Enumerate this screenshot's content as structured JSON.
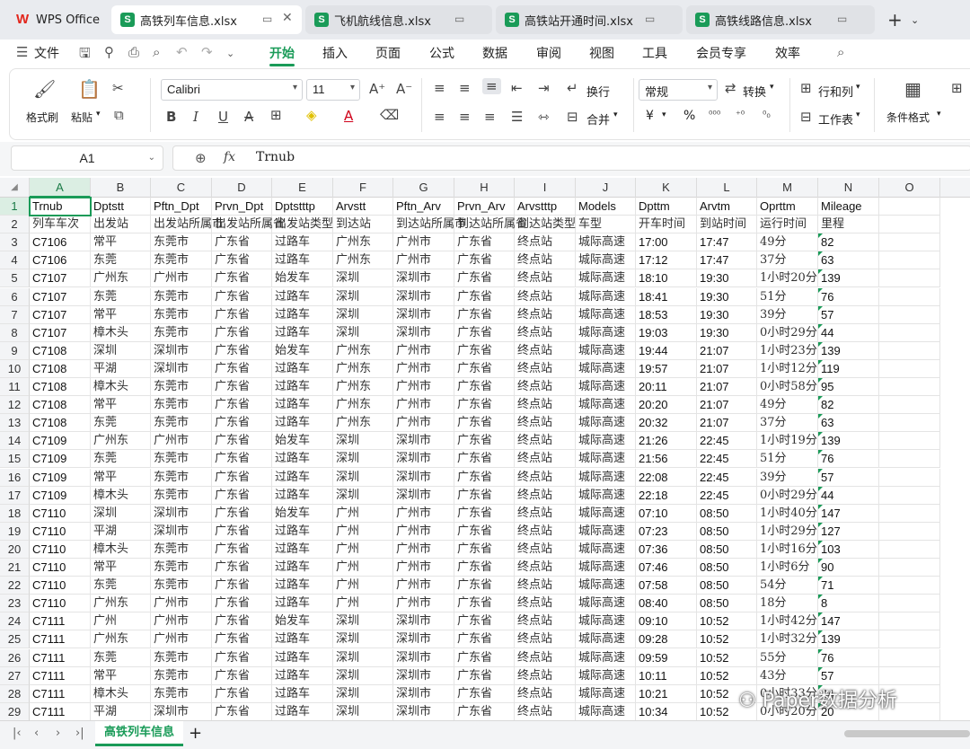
{
  "tabs": [
    {
      "label": "WPS Office",
      "type": "home"
    },
    {
      "label": "高铁列车信息.xlsx",
      "type": "active"
    },
    {
      "label": "飞机航线信息.xlsx",
      "type": "inactive"
    },
    {
      "label": "高铁站开通时间.xlsx",
      "type": "inactive"
    },
    {
      "label": "高铁线路信息.xlsx",
      "type": "inactive"
    }
  ],
  "menu": {
    "file": "文件",
    "items": [
      "开始",
      "插入",
      "页面",
      "公式",
      "数据",
      "审阅",
      "视图",
      "工具",
      "会员专享",
      "效率"
    ],
    "active": "开始"
  },
  "ribbon": {
    "format_painter": "格式刷",
    "paste": "粘贴",
    "font_name": "Calibri",
    "font_size": "11",
    "wrap": "换行",
    "number_format": "常规",
    "convert": "转换",
    "row_col": "行和列",
    "worksheet": "工作表",
    "cond_format": "条件格式",
    "merge": "合并",
    "currency": "¥",
    "percent": "%"
  },
  "formula": {
    "name_box": "A1",
    "fx": "fx",
    "value": "Trnub"
  },
  "columns": [
    "A",
    "B",
    "C",
    "D",
    "E",
    "F",
    "G",
    "H",
    "I",
    "J",
    "K",
    "L",
    "M",
    "N",
    "O"
  ],
  "selected_cell": "A1",
  "rows": [
    [
      "Trnub",
      "Dptstt",
      "Pftn_Dpt",
      "Prvn_Dpt",
      "Dptstttp",
      "Arvstt",
      "Pftn_Arv",
      "Prvn_Arv",
      "Arvstttp",
      "Models",
      "Dpttm",
      "Arvtm",
      "Oprttm",
      "Mileage"
    ],
    [
      "列车车次",
      "出发站",
      "出发站所属市",
      "出发站所属省",
      "出发站类型",
      "到达站",
      "到达站所属市",
      "到达站所属省",
      "到达站类型",
      "车型",
      "开车时间",
      "到站时间",
      "运行时间",
      "里程"
    ],
    [
      "C7106",
      "常平",
      "东莞市",
      "广东省",
      "过路车",
      "广州东",
      "广州市",
      "广东省",
      "终点站",
      "城际高速",
      "17:00",
      "17:47",
      "49分",
      "82"
    ],
    [
      "C7106",
      "东莞",
      "东莞市",
      "广东省",
      "过路车",
      "广州东",
      "广州市",
      "广东省",
      "终点站",
      "城际高速",
      "17:12",
      "17:47",
      "37分",
      "63"
    ],
    [
      "C7107",
      "广州东",
      "广州市",
      "广东省",
      "始发车",
      "深圳",
      "深圳市",
      "广东省",
      "终点站",
      "城际高速",
      "18:10",
      "19:30",
      "1小时20分",
      "139"
    ],
    [
      "C7107",
      "东莞",
      "东莞市",
      "广东省",
      "过路车",
      "深圳",
      "深圳市",
      "广东省",
      "终点站",
      "城际高速",
      "18:41",
      "19:30",
      "51分",
      "76"
    ],
    [
      "C7107",
      "常平",
      "东莞市",
      "广东省",
      "过路车",
      "深圳",
      "深圳市",
      "广东省",
      "终点站",
      "城际高速",
      "18:53",
      "19:30",
      "39分",
      "57"
    ],
    [
      "C7107",
      "樟木头",
      "东莞市",
      "广东省",
      "过路车",
      "深圳",
      "深圳市",
      "广东省",
      "终点站",
      "城际高速",
      "19:03",
      "19:30",
      "0小时29分",
      "44"
    ],
    [
      "C7108",
      "深圳",
      "深圳市",
      "广东省",
      "始发车",
      "广州东",
      "广州市",
      "广东省",
      "终点站",
      "城际高速",
      "19:44",
      "21:07",
      "1小时23分",
      "139"
    ],
    [
      "C7108",
      "平湖",
      "深圳市",
      "广东省",
      "过路车",
      "广州东",
      "广州市",
      "广东省",
      "终点站",
      "城际高速",
      "19:57",
      "21:07",
      "1小时12分",
      "119"
    ],
    [
      "C7108",
      "樟木头",
      "东莞市",
      "广东省",
      "过路车",
      "广州东",
      "广州市",
      "广东省",
      "终点站",
      "城际高速",
      "20:11",
      "21:07",
      "0小时58分",
      "95"
    ],
    [
      "C7108",
      "常平",
      "东莞市",
      "广东省",
      "过路车",
      "广州东",
      "广州市",
      "广东省",
      "终点站",
      "城际高速",
      "20:20",
      "21:07",
      "49分",
      "82"
    ],
    [
      "C7108",
      "东莞",
      "东莞市",
      "广东省",
      "过路车",
      "广州东",
      "广州市",
      "广东省",
      "终点站",
      "城际高速",
      "20:32",
      "21:07",
      "37分",
      "63"
    ],
    [
      "C7109",
      "广州东",
      "广州市",
      "广东省",
      "始发车",
      "深圳",
      "深圳市",
      "广东省",
      "终点站",
      "城际高速",
      "21:26",
      "22:45",
      "1小时19分",
      "139"
    ],
    [
      "C7109",
      "东莞",
      "东莞市",
      "广东省",
      "过路车",
      "深圳",
      "深圳市",
      "广东省",
      "终点站",
      "城际高速",
      "21:56",
      "22:45",
      "51分",
      "76"
    ],
    [
      "C7109",
      "常平",
      "东莞市",
      "广东省",
      "过路车",
      "深圳",
      "深圳市",
      "广东省",
      "终点站",
      "城际高速",
      "22:08",
      "22:45",
      "39分",
      "57"
    ],
    [
      "C7109",
      "樟木头",
      "东莞市",
      "广东省",
      "过路车",
      "深圳",
      "深圳市",
      "广东省",
      "终点站",
      "城际高速",
      "22:18",
      "22:45",
      "0小时29分",
      "44"
    ],
    [
      "C7110",
      "深圳",
      "深圳市",
      "广东省",
      "始发车",
      "广州",
      "广州市",
      "广东省",
      "终点站",
      "城际高速",
      "07:10",
      "08:50",
      "1小时40分",
      "147"
    ],
    [
      "C7110",
      "平湖",
      "深圳市",
      "广东省",
      "过路车",
      "广州",
      "广州市",
      "广东省",
      "终点站",
      "城际高速",
      "07:23",
      "08:50",
      "1小时29分",
      "127"
    ],
    [
      "C7110",
      "樟木头",
      "东莞市",
      "广东省",
      "过路车",
      "广州",
      "广州市",
      "广东省",
      "终点站",
      "城际高速",
      "07:36",
      "08:50",
      "1小时16分",
      "103"
    ],
    [
      "C7110",
      "常平",
      "东莞市",
      "广东省",
      "过路车",
      "广州",
      "广州市",
      "广东省",
      "终点站",
      "城际高速",
      "07:46",
      "08:50",
      "1小时6分",
      "90"
    ],
    [
      "C7110",
      "东莞",
      "东莞市",
      "广东省",
      "过路车",
      "广州",
      "广州市",
      "广东省",
      "终点站",
      "城际高速",
      "07:58",
      "08:50",
      "54分",
      "71"
    ],
    [
      "C7110",
      "广州东",
      "广州市",
      "广东省",
      "过路车",
      "广州",
      "广州市",
      "广东省",
      "终点站",
      "城际高速",
      "08:40",
      "08:50",
      "18分",
      "8"
    ],
    [
      "C7111",
      "广州",
      "广州市",
      "广东省",
      "始发车",
      "深圳",
      "深圳市",
      "广东省",
      "终点站",
      "城际高速",
      "09:10",
      "10:52",
      "1小时42分",
      "147"
    ],
    [
      "C7111",
      "广州东",
      "广州市",
      "广东省",
      "过路车",
      "深圳",
      "深圳市",
      "广东省",
      "终点站",
      "城际高速",
      "09:28",
      "10:52",
      "1小时32分",
      "139"
    ],
    [
      "C7111",
      "东莞",
      "东莞市",
      "广东省",
      "过路车",
      "深圳",
      "深圳市",
      "广东省",
      "终点站",
      "城际高速",
      "09:59",
      "10:52",
      "55分",
      "76"
    ],
    [
      "C7111",
      "常平",
      "东莞市",
      "广东省",
      "过路车",
      "深圳",
      "深圳市",
      "广东省",
      "终点站",
      "城际高速",
      "10:11",
      "10:52",
      "43分",
      "57"
    ],
    [
      "C7111",
      "樟木头",
      "东莞市",
      "广东省",
      "过路车",
      "深圳",
      "深圳市",
      "广东省",
      "终点站",
      "城际高速",
      "10:21",
      "10:52",
      "0小时33分",
      "44"
    ],
    [
      "C7111",
      "平湖",
      "深圳市",
      "广东省",
      "过路车",
      "深圳",
      "深圳市",
      "广东省",
      "终点站",
      "城际高速",
      "10:34",
      "10:52",
      "0小时20分",
      "20"
    ]
  ],
  "sheet": {
    "tab": "高铁列车信息",
    "add": "+"
  },
  "watermark": "Paper数据分析",
  "colors": {
    "accent": "#1a9b58",
    "selected_header": "#dbeee3"
  }
}
